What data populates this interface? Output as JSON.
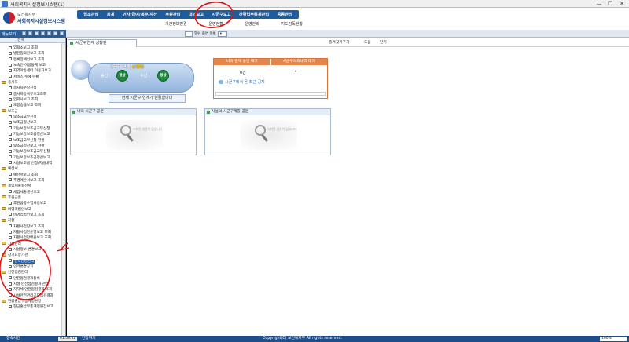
{
  "window": {
    "title": "사회복지시설정보시스템(1)",
    "minimize": "—",
    "restore": "❐",
    "close": "✕"
  },
  "logo": {
    "org": "보건복지부",
    "system": "사회복지시설정보시스템"
  },
  "top_menu": [
    "입소관리",
    "회계",
    "인사/급여/세무/자산",
    "후원관리",
    "대외보고",
    "시군구보고",
    "간편업무통계관리",
    "공동관리"
  ],
  "sub_menu": [
    "기관정보변경",
    "운영현황",
    "운영관리",
    "지도감독현황"
  ],
  "toolbar": {
    "menu_label": "메뉴보기",
    "combo_label": "열린 화면 목록"
  },
  "sidebar": {
    "header": "전체",
    "items": [
      {
        "label": "입퇴소보고 조회",
        "kind": "c"
      },
      {
        "label": "병원입퇴원보고 조회",
        "kind": "c"
      },
      {
        "label": "등록장애인보고 조회",
        "kind": "c"
      },
      {
        "label": "노숙인 이용통계 보고",
        "kind": "c"
      },
      {
        "label": "지역아동센터 이용자보고",
        "kind": "c"
      },
      {
        "label": "서비스 수혜 현황",
        "kind": "c"
      },
      {
        "label": "종사자",
        "kind": "f"
      },
      {
        "label": "종사자수당신청",
        "kind": "c"
      },
      {
        "label": "종사자등록부보고조회",
        "kind": "c"
      },
      {
        "label": "입퇴사보고 조회",
        "kind": "c"
      },
      {
        "label": "호봉승급보고 조회",
        "kind": "c"
      },
      {
        "label": "보조금",
        "kind": "f"
      },
      {
        "label": "보조금교부신청",
        "kind": "c"
      },
      {
        "label": "보조금정산보고",
        "kind": "c"
      },
      {
        "label": "기능보강보조금교부신청",
        "kind": "c"
      },
      {
        "label": "기능보강보조금정산보고",
        "kind": "c"
      },
      {
        "label": "보조금교부신청 현황",
        "kind": "c"
      },
      {
        "label": "보조금정산보고 현황",
        "kind": "c"
      },
      {
        "label": "기능보강보조금교부신청",
        "kind": "c"
      },
      {
        "label": "기능보강보조금정산보고",
        "kind": "c"
      },
      {
        "label": "시설보조금 신청/지급내역",
        "kind": "c"
      },
      {
        "label": "예산서",
        "kind": "f"
      },
      {
        "label": "예산서보고 조회",
        "kind": "c"
      },
      {
        "label": "추경예산서보고 조회",
        "kind": "c"
      },
      {
        "label": "세입세출결산서",
        "kind": "f"
      },
      {
        "label": "세입세출결산보고",
        "kind": "c"
      },
      {
        "label": "후원금품",
        "kind": "f"
      },
      {
        "label": "후원금품수입사용보고",
        "kind": "c"
      },
      {
        "label": "비영리법인보고",
        "kind": "f"
      },
      {
        "label": "비영리법인보고 조회",
        "kind": "c"
      },
      {
        "label": "자활",
        "kind": "f"
      },
      {
        "label": "자활사업단보고 조회",
        "kind": "c"
      },
      {
        "label": "자활사업단운영보고 조회",
        "kind": "c"
      },
      {
        "label": "자활사업단매출보고 조회",
        "kind": "c"
      },
      {
        "label": "시설관리",
        "kind": "f"
      },
      {
        "label": "시설정보 변경보고",
        "kind": "c"
      },
      {
        "label": "장기요양기관",
        "kind": "f"
      },
      {
        "label": "인력변경관리",
        "kind": "c",
        "selected": true
      },
      {
        "label": "인력변경공지",
        "kind": "c"
      },
      {
        "label": "안전점검관리",
        "kind": "f"
      },
      {
        "label": "안전점검결과등록",
        "kind": "c"
      },
      {
        "label": "시설 안전점검결과 관리",
        "kind": "c"
      },
      {
        "label": "지자체 안전점검결과 조회",
        "kind": "c"
      },
      {
        "label": "시설안전관리공단점검결과",
        "kind": "c"
      },
      {
        "label": "현금출납부총계정원장",
        "kind": "f"
      },
      {
        "label": "현금출납부총계정원장보고",
        "kind": "c"
      }
    ]
  },
  "main": {
    "tab_label": "시군구연계 상황판",
    "favorites_button": "즐겨찾기추가",
    "help_button": "도움",
    "close_button": "닫기"
  },
  "status_widget": {
    "title_prefix": "시군구 연계",
    "title_highlight": "상황판",
    "send_label": "송신 :",
    "send_status": "정상",
    "receive_label": "수신 :",
    "receive_status": "정상",
    "banner": "현재 시군구 연계가 원활합니다"
  },
  "right_panel": {
    "header_left": "나의 결재 승인 대기",
    "header_right": "시군구의뢰내역 대기",
    "count": "0건",
    "notice": "시군구에서 온 최근 공지"
  },
  "panels": [
    {
      "title": "나의 시군구 공문",
      "empty_text": "조회된 내용이 없습니다"
    },
    {
      "title": "시설의 시군구제출 공문",
      "empty_text": "조회된 내용이 없습니다"
    }
  ],
  "statusbar": {
    "left_label": "접속시간",
    "clock": "01:58:52",
    "logout": "연장하기",
    "copyright": "Copyright(C) 보건복지부 All rights reserved.",
    "zoom": "100%"
  },
  "colors": {
    "nav_blue": "#1f5c9e",
    "accent_orange": "#e2864c",
    "status_green": "#1d8a3c",
    "annotation_red": "#e01010"
  }
}
